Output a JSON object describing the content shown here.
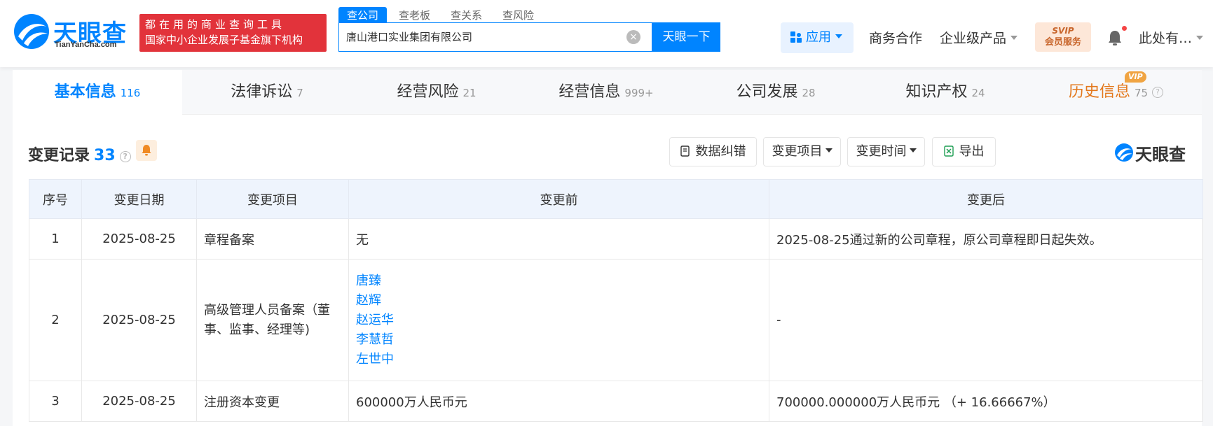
{
  "logo": {
    "text": "天眼查",
    "sub": "TianYanCha.com"
  },
  "slogan": {
    "line1": "都在用的商业查询工具",
    "line2": "国家中小企业发展子基金旗下机构"
  },
  "search": {
    "tabs": [
      "查公司",
      "查老板",
      "查关系",
      "查风险"
    ],
    "value": "唐山港口实业集团有限公司",
    "clear": "×",
    "button": "天眼一下"
  },
  "nav": {
    "app": "应用",
    "business": "商务合作",
    "enterprise": "企业级产品",
    "svip_top": "SVIP",
    "svip_bottom": "会员服务",
    "user": "此处有…"
  },
  "tabs": [
    {
      "label": "基本信息",
      "count": "116"
    },
    {
      "label": "法律诉讼",
      "count": "7"
    },
    {
      "label": "经营风险",
      "count": "21"
    },
    {
      "label": "经营信息",
      "count": "999+"
    },
    {
      "label": "公司发展",
      "count": "28"
    },
    {
      "label": "知识产权",
      "count": "24"
    },
    {
      "label": "历史信息",
      "count": "75"
    }
  ],
  "vip_badge": "VIP",
  "help": "?",
  "section": {
    "title": "变更记录",
    "count": "33",
    "tools": {
      "correct": "数据纠错",
      "item": "变更项目",
      "time": "变更时间",
      "export": "导出"
    },
    "brand": "天眼查"
  },
  "table": {
    "headers": [
      "序号",
      "变更日期",
      "变更项目",
      "变更前",
      "变更后"
    ],
    "rows": [
      {
        "no": "1",
        "date": "2025-08-25",
        "item": "章程备案",
        "before": "无",
        "after": "2025-08-25通过新的公司章程，原公司章程即日起失效。"
      },
      {
        "no": "2",
        "date": "2025-08-25",
        "item": "高级管理人员备案（董事、监事、经理等)",
        "before_people": [
          "唐臻",
          "赵辉",
          "赵运华",
          "李慧哲",
          "左世中"
        ],
        "after": "-"
      },
      {
        "no": "3",
        "date": "2025-08-25",
        "item": "注册资本变更",
        "before": "600000万人民币元",
        "after": "700000.000000万人民币元 （+ 16.66667%）"
      }
    ]
  },
  "colors": {
    "accent": "#0084ff",
    "red": "#f04444",
    "orange": "#e3781c",
    "slogan_bg": "#e2333b"
  }
}
